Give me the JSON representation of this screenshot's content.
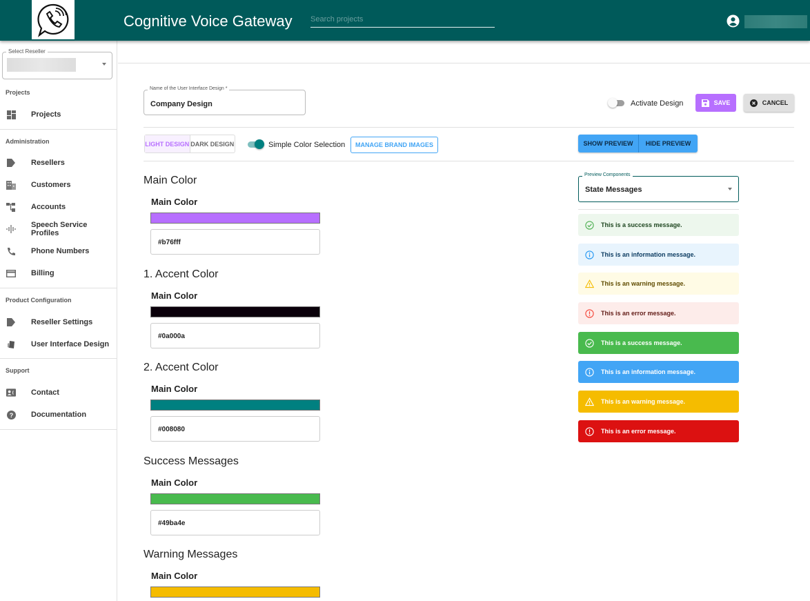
{
  "header": {
    "title": "Cognitive Voice Gateway",
    "search_placeholder": "Search projects",
    "logo": "phone-chat-icon",
    "user_icon": "account-circle-icon"
  },
  "sidebar": {
    "reseller_label": "Select Reseller",
    "sections": [
      {
        "label": "Projects",
        "items": [
          {
            "label": "Projects",
            "icon": "dashboard-icon"
          }
        ]
      },
      {
        "label": "Administration",
        "items": [
          {
            "label": "Resellers",
            "icon": "tag-icon"
          },
          {
            "label": "Customers",
            "icon": "building-icon"
          },
          {
            "label": "Accounts",
            "icon": "hierarchy-icon"
          },
          {
            "label": "Speech Service Profiles",
            "icon": "waveform-icon"
          },
          {
            "label": "Phone Numbers",
            "icon": "phone-icon"
          },
          {
            "label": "Billing",
            "icon": "credit-card-icon"
          }
        ]
      },
      {
        "label": "Product Configuration",
        "items": [
          {
            "label": "Reseller Settings",
            "icon": "tag-icon"
          },
          {
            "label": "User Interface Design",
            "icon": "palette-icon"
          }
        ]
      },
      {
        "label": "Support",
        "items": [
          {
            "label": "Contact",
            "icon": "contact-icon"
          },
          {
            "label": "Documentation",
            "icon": "help-icon"
          }
        ]
      }
    ]
  },
  "form": {
    "name_label": "Name of the User Interface Design *",
    "name_value": "Company Design",
    "activate_label": "Activate Design",
    "activate_on": false,
    "save_label": "SAVE",
    "cancel_label": "CANCEL",
    "light_design": "LIGHT DESIGN",
    "dark_design": "DARK DESIGN",
    "simple_color_label": "Simple Color Selection",
    "simple_color_on": true,
    "manage_brand_images": "MANAGE BRAND IMAGES",
    "show_preview": "SHOW PREVIEW",
    "hide_preview": "HIDE PREVIEW"
  },
  "colors": [
    {
      "group": "Main Color",
      "sub": "Main Color",
      "hex": "#b76fff"
    },
    {
      "group": "1. Accent Color",
      "sub": "Main Color",
      "hex": "#0a000a"
    },
    {
      "group": "2. Accent Color",
      "sub": "Main Color",
      "hex": "#008080"
    },
    {
      "group": "Success Messages",
      "sub": "Main Color",
      "hex": "#49ba4e"
    },
    {
      "group": "Warning Messages",
      "sub": "Main Color",
      "hex": "#f5bc00"
    }
  ],
  "preview": {
    "select_label": "Preview Components",
    "select_value": "State Messages",
    "messages": [
      {
        "text": "This is a success message.",
        "icon": "check-circle-icon",
        "bg": "#edf7ed",
        "fg": "#1e4620",
        "ic": "#4caf50"
      },
      {
        "text": "This is an information message.",
        "icon": "info-icon",
        "bg": "#e8f4fd",
        "fg": "#0d3c61",
        "ic": "#2196f3"
      },
      {
        "text": "This is an warning message.",
        "icon": "warning-icon",
        "bg": "#fffbe5",
        "fg": "#5f4b00",
        "ic": "#f5bc00"
      },
      {
        "text": "This is an error message.",
        "icon": "error-icon",
        "bg": "#fdecea",
        "fg": "#611a15",
        "ic": "#f44336"
      },
      {
        "text": "This is a success message.",
        "icon": "check-circle-icon",
        "bg": "#49ba4e",
        "fg": "#ffffff",
        "ic": "#ffffff"
      },
      {
        "text": "This is an information message.",
        "icon": "info-icon",
        "bg": "#42a5f5",
        "fg": "#ffffff",
        "ic": "#ffffff"
      },
      {
        "text": "This is an warning message.",
        "icon": "warning-icon",
        "bg": "#f5bc00",
        "fg": "#ffffff",
        "ic": "#ffffff"
      },
      {
        "text": "This is an error message.",
        "icon": "error-icon",
        "bg": "#dc1111",
        "fg": "#ffffff",
        "ic": "#ffffff"
      }
    ]
  },
  "theme": {
    "header_bg": "#005a5a",
    "primary": "#b76fff",
    "blue": "#42a5f5",
    "teal": "#008080"
  }
}
